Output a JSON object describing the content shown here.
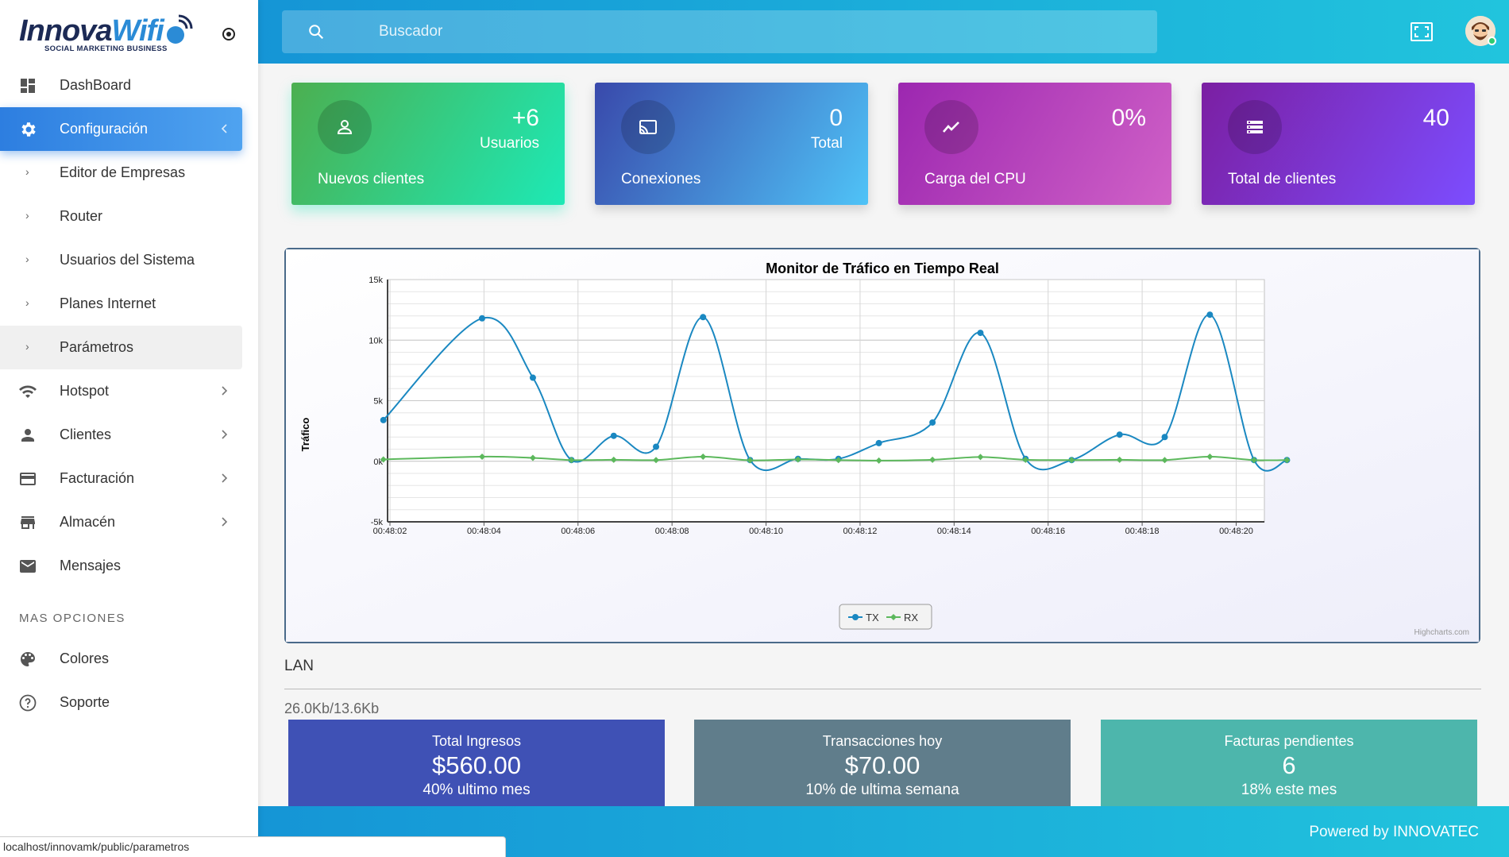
{
  "brand": {
    "logo_main": "Innova",
    "logo_accent": "Wifi",
    "logo_sub": "SOCIAL MARKETING BUSINESS"
  },
  "sidebar": {
    "items": [
      {
        "label": "DashBoard",
        "icon": "dashboard-icon"
      },
      {
        "label": "Configuración",
        "icon": "gear-icon",
        "active": true
      },
      {
        "label": "Editor de Empresas",
        "sub": true
      },
      {
        "label": "Router",
        "sub": true
      },
      {
        "label": "Usuarios del Sistema",
        "sub": true
      },
      {
        "label": "Planes Internet",
        "sub": true
      },
      {
        "label": "Parámetros",
        "sub": true,
        "hover": true
      },
      {
        "label": "Hotspot",
        "icon": "wifi-icon"
      },
      {
        "label": "Clientes",
        "icon": "person-icon"
      },
      {
        "label": "Facturación",
        "icon": "credit-card-icon"
      },
      {
        "label": "Almacén",
        "icon": "store-icon"
      },
      {
        "label": "Mensajes",
        "icon": "mail-icon"
      }
    ],
    "more_heading": "MAS OPCIONES",
    "more_items": [
      {
        "label": "Colores",
        "icon": "palette-icon"
      },
      {
        "label": "Soporte",
        "icon": "help-icon"
      }
    ],
    "sub_marker": "›"
  },
  "search": {
    "placeholder": "Buscador",
    "value": ""
  },
  "cards": [
    {
      "value": "+6",
      "unit": "Usuarios",
      "title": "Nuevos clientes",
      "icon": "person-outline-icon"
    },
    {
      "value": "0",
      "unit": "Total",
      "title": "Conexiones",
      "icon": "cast-icon"
    },
    {
      "value": "0%",
      "unit": "",
      "title": "Carga del CPU",
      "icon": "trend-icon"
    },
    {
      "value": "40",
      "unit": "",
      "title": "Total de clientes",
      "icon": "storage-icon"
    }
  ],
  "chart_data": {
    "type": "line",
    "title": "Monitor de Tráfico en Tiempo Real",
    "ylabel": "Tráfico",
    "xlabel": "",
    "ylim": [
      -5000,
      15000
    ],
    "yticks": [
      -5000,
      0,
      5000,
      10000,
      15000
    ],
    "ytick_labels": [
      "-5k",
      "0k",
      "5k",
      "10k",
      "15k"
    ],
    "x_range": [
      0,
      9.3
    ],
    "xticks": [
      0,
      1,
      2,
      3,
      4,
      5,
      6,
      7,
      8,
      9
    ],
    "xtick_labels": [
      "00:48:02",
      "00:48:04",
      "00:48:06",
      "00:48:08",
      "00:48:10",
      "00:48:12",
      "00:48:14",
      "00:48:16",
      "00:48:18",
      "00:48:20"
    ],
    "grid": true,
    "legend": "bottom-center",
    "credit": "Highcharts.com",
    "series": [
      {
        "name": "TX",
        "color": "#1a88c1",
        "x": [
          -0.07,
          0.98,
          1.52,
          1.93,
          2.38,
          2.83,
          3.33,
          3.83,
          4.34,
          4.77,
          5.2,
          5.77,
          6.28,
          6.76,
          7.25,
          7.76,
          8.24,
          8.72,
          9.19,
          9.54
        ],
        "y": [
          3400,
          11800,
          6900,
          100,
          2100,
          1200,
          11900,
          100,
          200,
          200,
          1500,
          3200,
          10600,
          200,
          100,
          2200,
          2000,
          12100,
          100,
          100
        ]
      },
      {
        "name": "RX",
        "color": "#5cb85c",
        "x": [
          -0.07,
          0.98,
          1.52,
          1.93,
          2.38,
          2.83,
          3.33,
          3.83,
          4.34,
          4.77,
          5.2,
          5.77,
          6.28,
          6.76,
          7.25,
          7.76,
          8.24,
          8.72,
          9.19,
          9.54
        ],
        "y": [
          150,
          380,
          280,
          100,
          120,
          100,
          380,
          80,
          150,
          100,
          60,
          120,
          350,
          120,
          100,
          120,
          100,
          380,
          100,
          100
        ]
      }
    ]
  },
  "lan": {
    "label": "LAN",
    "value": "26.0Kb/13.6Kb"
  },
  "bottom_cards": [
    {
      "title": "Total Ingresos",
      "value": "$560.00",
      "sub": "40% ultimo mes"
    },
    {
      "title": "Transacciones hoy",
      "value": "$70.00",
      "sub": "10% de ultima semana"
    },
    {
      "title": "Facturas pendientes",
      "value": "6",
      "sub": "18% este mes"
    }
  ],
  "footer": {
    "prefix": "Powered by",
    "brand": "INNOVATEC"
  },
  "statusbar": {
    "url": "localhost/innovamk/public/parametros"
  }
}
